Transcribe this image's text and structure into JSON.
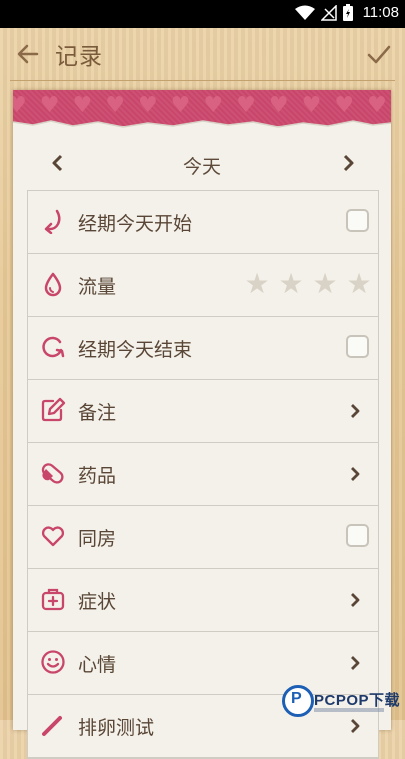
{
  "status_bar": {
    "time": "11:08"
  },
  "app_bar": {
    "title": "记录"
  },
  "date_nav": {
    "label": "今天"
  },
  "rows": [
    {
      "label": "经期今天开始",
      "control": "checkbox",
      "checked": false
    },
    {
      "label": "流量",
      "control": "stars",
      "rating": 0,
      "max": 4
    },
    {
      "label": "经期今天结束",
      "control": "checkbox",
      "checked": false
    },
    {
      "label": "备注",
      "control": "chevron"
    },
    {
      "label": "药品",
      "control": "chevron"
    },
    {
      "label": "同房",
      "control": "checkbox",
      "checked": false
    },
    {
      "label": "症状",
      "control": "chevron"
    },
    {
      "label": "心情",
      "control": "chevron"
    },
    {
      "label": "排卵测试",
      "control": "chevron"
    }
  ],
  "icons": [
    "back-arrow-icon",
    "check-icon",
    "arrow-curve-icon",
    "drop-icon",
    "refresh-icon",
    "edit-icon",
    "pill-icon",
    "heart-icon",
    "first-aid-icon",
    "smile-icon",
    "test-strip-icon"
  ],
  "colors": {
    "accent": "#c9466b",
    "text": "#5a4636",
    "paper": "#f3f1ea",
    "wood": "#e6c996"
  },
  "watermark": {
    "text": "PCPOP下载",
    "logo": "P"
  }
}
